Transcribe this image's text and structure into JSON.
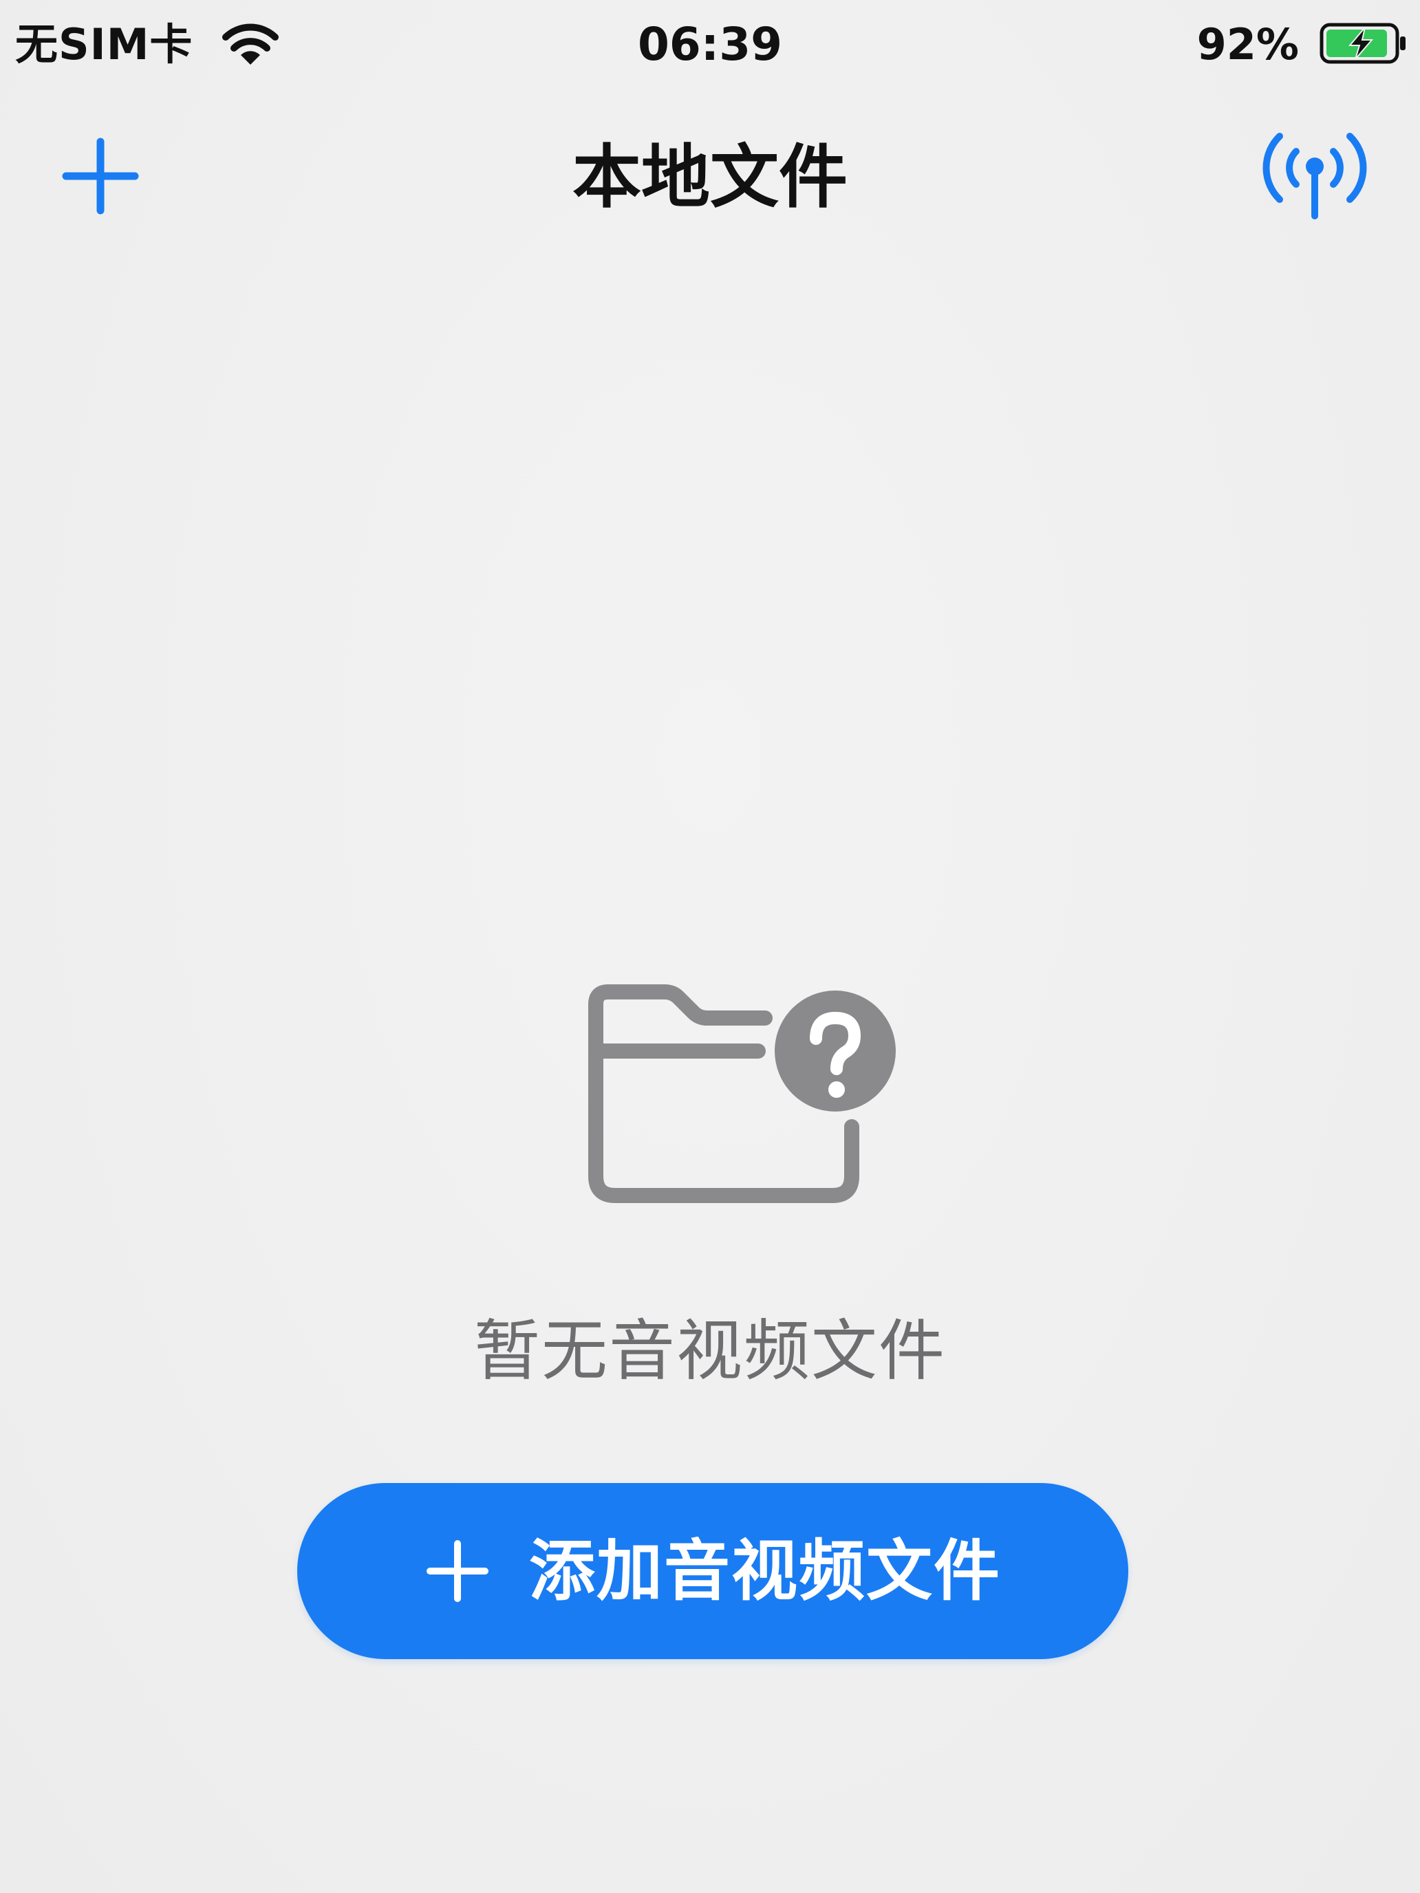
{
  "status_bar": {
    "carrier": "无SIM卡",
    "time": "06:39",
    "battery_percent": "92%",
    "battery_level": 0.92,
    "charging": true,
    "icons": [
      "wifi-icon",
      "battery-charging-icon"
    ]
  },
  "nav_bar": {
    "title": "本地文件",
    "left_action_icon": "plus-icon",
    "right_action_icon": "broadcast-antenna-icon"
  },
  "empty_state": {
    "icon": "folder-question-icon",
    "message": "暂无音视频文件"
  },
  "primary_action": {
    "icon": "plus-icon",
    "label": "添加音视频文件"
  },
  "colors": {
    "accent": "#1A7CF2",
    "background": "#F0F0F0",
    "icon_gray": "#8A8A8C",
    "text_secondary": "#6E6E70",
    "battery_green": "#34C759"
  }
}
